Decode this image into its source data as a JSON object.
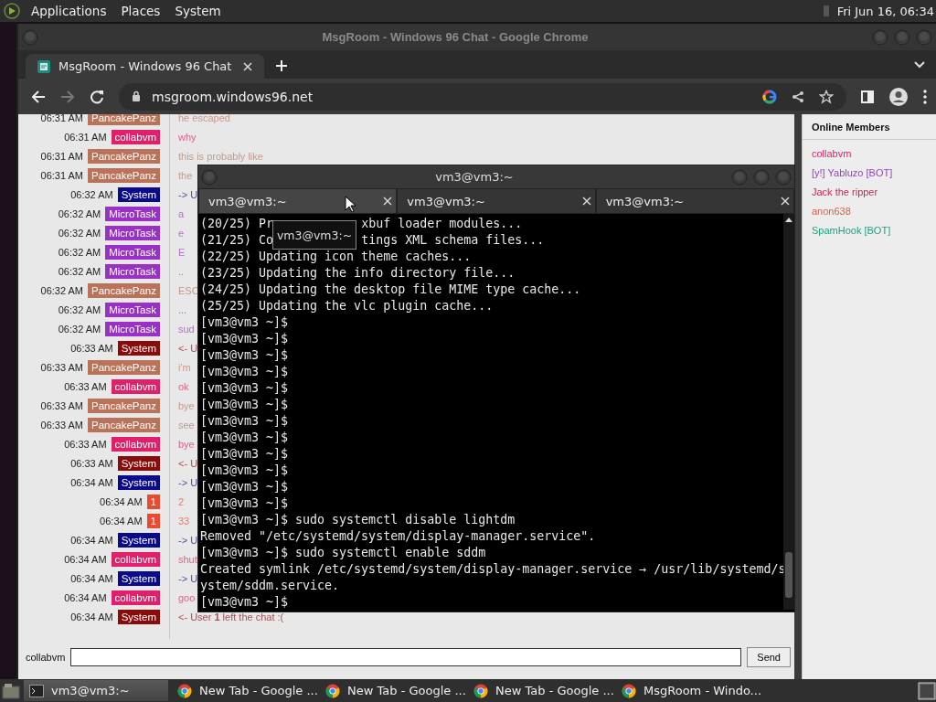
{
  "top_panel": {
    "menus": [
      "Applications",
      "Places",
      "System"
    ],
    "clock": "Fri Jun 16, 06:34"
  },
  "browser": {
    "window_title": "MsgRoom - Windows 96 Chat - Google Chrome",
    "tabs": [
      {
        "label": "MsgRoom - Windows 96 Chat",
        "selected": true
      }
    ],
    "address": "msgroom.windows96.net",
    "forward_disabled": true
  },
  "chat": {
    "messages": [
      {
        "time": "06:31 AM",
        "name": "PancakePanz",
        "color": "#b8735a",
        "text": "he escaped"
      },
      {
        "time": "06:31 AM",
        "name": "collabvm",
        "color": "#e0206a",
        "text": "why"
      },
      {
        "time": "06:31 AM",
        "name": "PancakePanz",
        "color": "#b8735a",
        "text": "this is probably like"
      },
      {
        "time": "06:31 AM",
        "name": "PancakePanz",
        "color": "#b8735a",
        "text": "the"
      },
      {
        "time": "06:32 AM",
        "name": "System",
        "color": "#0a0a8c",
        "text": "-> U"
      },
      {
        "time": "06:32 AM",
        "name": "MicroTask",
        "color": "#9b30c8",
        "text": "a"
      },
      {
        "time": "06:32 AM",
        "name": "MicroTask",
        "color": "#9b30c8",
        "text": "e"
      },
      {
        "time": "06:32 AM",
        "name": "MicroTask",
        "color": "#9b30c8",
        "text": "E"
      },
      {
        "time": "06:32 AM",
        "name": "MicroTask",
        "color": "#9b30c8",
        "text": ".."
      },
      {
        "time": "06:32 AM",
        "name": "PancakePanz",
        "color": "#b8735a",
        "text": "ESC"
      },
      {
        "time": "06:32 AM",
        "name": "MicroTask",
        "color": "#9b30c8",
        "text": "..."
      },
      {
        "time": "06:32 AM",
        "name": "MicroTask",
        "color": "#9b30c8",
        "text": "sud"
      },
      {
        "time": "06:33 AM",
        "name": "System",
        "color": "#8b0a0a",
        "text": "<- U"
      },
      {
        "time": "06:33 AM",
        "name": "PancakePanz",
        "color": "#b8735a",
        "text": "i'm"
      },
      {
        "time": "06:33 AM",
        "name": "collabvm",
        "color": "#e0206a",
        "text": "ok"
      },
      {
        "time": "06:33 AM",
        "name": "PancakePanz",
        "color": "#b8735a",
        "text": "bye"
      },
      {
        "time": "06:33 AM",
        "name": "PancakePanz",
        "color": "#b8735a",
        "text": "see"
      },
      {
        "time": "06:33 AM",
        "name": "collabvm",
        "color": "#e0206a",
        "text": "bye"
      },
      {
        "time": "06:33 AM",
        "name": "System",
        "color": "#8b0a0a",
        "text": "<- U"
      },
      {
        "time": "06:34 AM",
        "name": "System",
        "color": "#0a0a8c",
        "text": "-> U"
      },
      {
        "time": "06:34 AM",
        "name": "1",
        "color": "#e84a32",
        "text": "2"
      },
      {
        "time": "06:34 AM",
        "name": "1",
        "color": "#e84a32",
        "text": "33"
      },
      {
        "time": "06:34 AM",
        "name": "System",
        "color": "#0a0a8c",
        "text": "-> U"
      },
      {
        "time": "06:34 AM",
        "name": "collabvm",
        "color": "#e0206a",
        "text": "shut"
      },
      {
        "time": "06:34 AM",
        "name": "System",
        "color": "#0a0a8c",
        "text": "-> U"
      },
      {
        "time": "06:34 AM",
        "name": "collabvm",
        "color": "#e0206a",
        "text": "goo"
      },
      {
        "time": "06:34 AM",
        "name": "System",
        "color": "#8b0a0a",
        "text": "<- User **1** left the chat :("
      }
    ],
    "members_title": "Online Members",
    "members": [
      {
        "name": "collabvm",
        "color": "#e0206a"
      },
      {
        "name": "[y!] Yabluzo [BOT]",
        "color": "#9a40c0"
      },
      {
        "name": "Jack the ripper",
        "color": "#d0205a"
      },
      {
        "name": "anon638",
        "color": "#e85a40"
      },
      {
        "name": "SpamHook [BOT]",
        "color": "#20a080"
      }
    ],
    "input_label": "collabvm",
    "send": "Send"
  },
  "terminal": {
    "title": "vm3@vm3:~",
    "tabs": [
      {
        "label": "vm3@vm3:~",
        "selected": true
      },
      {
        "label": "vm3@vm3:~",
        "selected": false
      },
      {
        "label": "vm3@vm3:~",
        "selected": false
      }
    ],
    "lines": [
      [
        "(20/25) Pr",
        "xbuf loader modules..."
      ],
      [
        "(21/25) Co",
        "tings XML schema files..."
      ],
      [
        "(22/25) Updating icon theme caches..."
      ],
      [
        "(23/25) Updating the info directory file..."
      ],
      [
        "(24/25) Updating the desktop file MIME type cache..."
      ],
      [
        "(25/25) Updating the vlc plugin cache..."
      ],
      [
        "[vm3@vm3 ~]$"
      ],
      [
        "[vm3@vm3 ~]$"
      ],
      [
        "[vm3@vm3 ~]$"
      ],
      [
        "[vm3@vm3 ~]$"
      ],
      [
        "[vm3@vm3 ~]$"
      ],
      [
        "[vm3@vm3 ~]$"
      ],
      [
        "[vm3@vm3 ~]$"
      ],
      [
        "[vm3@vm3 ~]$"
      ],
      [
        "[vm3@vm3 ~]$"
      ],
      [
        "[vm3@vm3 ~]$"
      ],
      [
        "[vm3@vm3 ~]$"
      ],
      [
        "[vm3@vm3 ~]$"
      ],
      [
        "[vm3@vm3 ~]$ sudo systemctl disable lightdm"
      ],
      [
        "Removed \"/etc/systemd/system/display-manager.service\"."
      ],
      [
        "[vm3@vm3 ~]$ sudo systemctl enable sddm"
      ],
      [
        "Created symlink /etc/systemd/system/display-manager.service → /usr/lib/systemd/s"
      ],
      [
        "ystem/sddm.service."
      ],
      [
        "[vm3@vm3 ~]$"
      ]
    ],
    "tooltip": "vm3@vm3:~"
  },
  "taskbar": {
    "items": [
      {
        "kind": "terminal",
        "label": "vm3@vm3:~",
        "selected": true
      },
      {
        "kind": "chrome",
        "label": "New Tab - Google ...",
        "selected": false
      },
      {
        "kind": "chrome",
        "label": "New Tab - Google ...",
        "selected": false
      },
      {
        "kind": "chrome",
        "label": "New Tab - Google ...",
        "selected": false
      },
      {
        "kind": "chrome",
        "label": "MsgRoom - Windo...",
        "selected": false
      }
    ]
  }
}
